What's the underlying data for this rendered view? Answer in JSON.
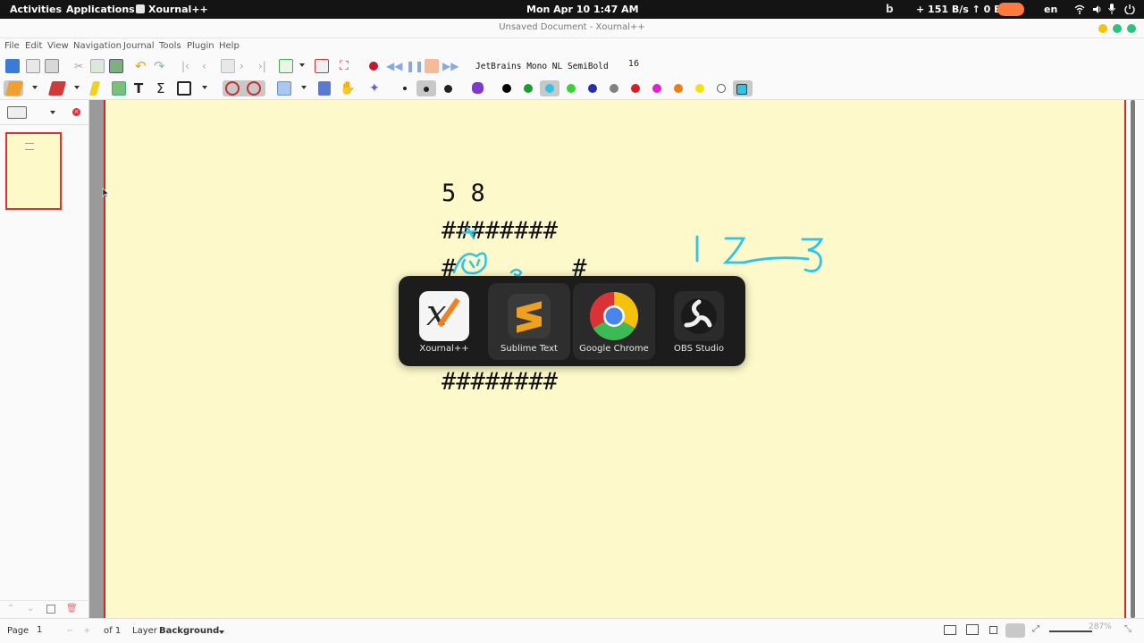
{
  "topbar": {
    "activities": "Activities",
    "applications": "Applications",
    "active_app": "Xournal++",
    "clock": "Mon Apr 10   1:47 AM",
    "network_speed": "+ 151 B/s ↑ 0 B/s",
    "language": "en"
  },
  "window": {
    "title": "Unsaved Document - Xournal++"
  },
  "menubar": {
    "items": [
      "File",
      "Edit",
      "View",
      "Navigation",
      "Journal",
      "Tools",
      "Plugin",
      "Help"
    ]
  },
  "toolbar": {
    "font_name": "JetBrains Mono NL SemiBold",
    "font_size": "16",
    "pen_colors": [
      "#000000",
      "#1a9e2f",
      "#2fc4e6",
      "#33d633",
      "#2b2bb0",
      "#808080",
      "#d61f1f",
      "#e01fd6",
      "#f07d14",
      "#f0e214",
      "#ffffff"
    ],
    "selected_color": "#2fc4e6"
  },
  "page_content": {
    "line1": "5 8",
    "line2": "########",
    "line3": "#        #",
    "line_last": "########",
    "handwriting": "1 2 3",
    "ink_color": "#2fc4e6"
  },
  "app_switcher": {
    "apps": [
      {
        "name": "Xournal++",
        "icon": "xournal-icon"
      },
      {
        "name": "Sublime Text",
        "icon": "sublime-icon"
      },
      {
        "name": "Google Chrome",
        "icon": "chrome-icon"
      },
      {
        "name": "OBS Studio",
        "icon": "obs-icon"
      }
    ],
    "selected_index": 2
  },
  "statusbar": {
    "page_label": "Page",
    "page_number": "1",
    "of_pages": "of 1",
    "layer_label": "Layer",
    "layer_value": "Background",
    "zoom": "287%"
  }
}
